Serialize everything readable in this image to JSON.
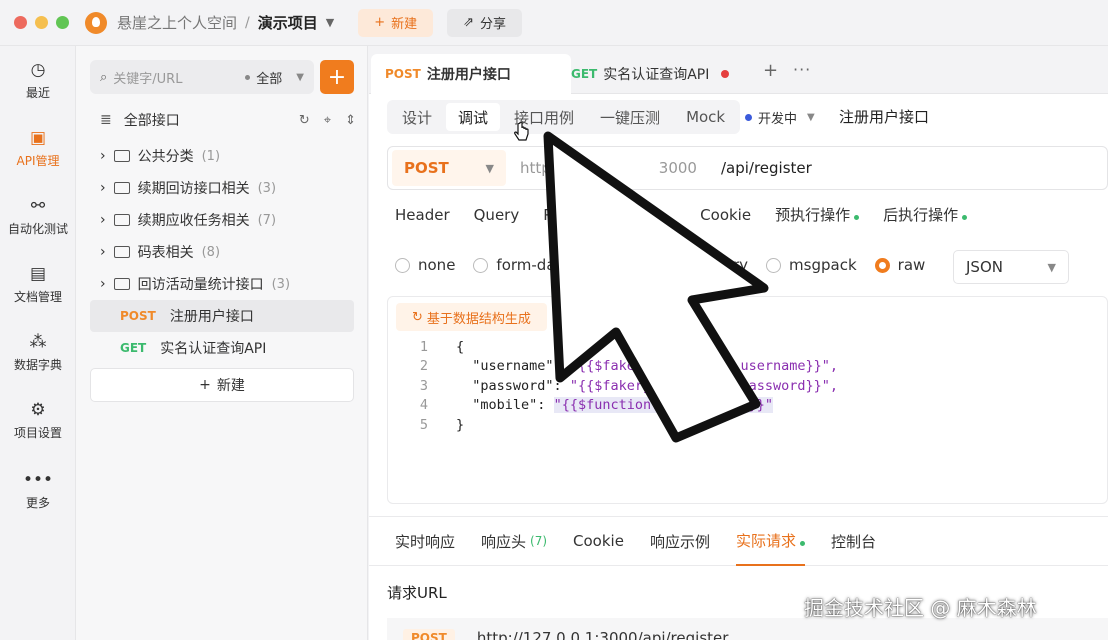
{
  "titlebar": {
    "space_name": "悬崖之上个人空间",
    "separator": "/",
    "project_name": "演示项目",
    "new_label": "新建",
    "share_label": "分享"
  },
  "rail": [
    {
      "label": "最近",
      "icon": "clock-icon"
    },
    {
      "label": "API管理",
      "icon": "api-icon",
      "active": true
    },
    {
      "label": "自动化测试",
      "icon": "automation-icon"
    },
    {
      "label": "文档管理",
      "icon": "document-icon"
    },
    {
      "label": "数据字典",
      "icon": "dictionary-icon"
    },
    {
      "label": "项目设置",
      "icon": "settings-icon"
    },
    {
      "label": "更多",
      "icon": "more-icon"
    }
  ],
  "sidebar": {
    "search_placeholder": "关键字/URL",
    "filter_label": "全部",
    "add_label": "+",
    "tree_title": "全部接口",
    "folders": [
      {
        "name": "公共分类",
        "count": "(1)"
      },
      {
        "name": "续期回访接口相关",
        "count": "(3)"
      },
      {
        "name": "续期应收任务相关",
        "count": "(7)"
      },
      {
        "name": "码表相关",
        "count": "(8)"
      },
      {
        "name": "回访活动量统计接口",
        "count": "(3)"
      }
    ],
    "endpoints": [
      {
        "method": "POST",
        "name": "注册用户接口",
        "selected": true
      },
      {
        "method": "GET",
        "name": "实名认证查询API"
      }
    ],
    "new_label": "新建"
  },
  "tabs": [
    {
      "method": "POST",
      "name": "注册用户接口",
      "active": true
    },
    {
      "method": "GET",
      "name": "实名认证查询API",
      "unsaved": true
    }
  ],
  "mode_tabs": [
    "设计",
    "调试",
    "接口用例",
    "一键压测",
    "Mock"
  ],
  "mode_active": "调试",
  "status": "开发中",
  "api_name": "注册用户接口",
  "request": {
    "method": "POST",
    "host_visible": "http",
    "host_tail": "3000",
    "path": "/api/register"
  },
  "param_tabs": [
    {
      "label": "Header"
    },
    {
      "label": "Query"
    },
    {
      "label": "Path"
    },
    {
      "label": "Cookie"
    },
    {
      "label": "预执行操作",
      "dot": true
    },
    {
      "label": "后执行操作",
      "dot": true
    }
  ],
  "body_types": [
    {
      "label": "none"
    },
    {
      "label": "form-data"
    },
    {
      "label": "binary"
    },
    {
      "label": "msgpack"
    },
    {
      "label": "raw",
      "checked": true
    }
  ],
  "body_format": "JSON",
  "generate_label": "基于数据结构生成",
  "code_lines": [
    {
      "n": "1",
      "text": "{"
    },
    {
      "n": "2",
      "key": "\"username\"",
      "val": "\"{{$fakerjs.Internet.username}}\","
    },
    {
      "n": "3",
      "key": "\"password\"",
      "val": "\"{{$fakerjs.Internet.password}}\","
    },
    {
      "n": "4",
      "key": "\"mobile\"",
      "val": "\"{{$function.fn_mobile()}}\""
    },
    {
      "n": "5",
      "text": "}"
    }
  ],
  "response_tabs": [
    {
      "label": "实时响应"
    },
    {
      "label": "响应头",
      "count": "(7)"
    },
    {
      "label": "Cookie"
    },
    {
      "label": "响应示例"
    },
    {
      "label": "实际请求",
      "active": true,
      "dot": true
    },
    {
      "label": "控制台"
    }
  ],
  "request_url_label": "请求URL",
  "request_url": {
    "method": "POST",
    "url": "http://127.0.0.1:3000/api/register"
  },
  "watermark": "掘金技术社区 @ 麻木森林",
  "colors": {
    "accent": "#f07c1e",
    "post": "#f08a2a",
    "get": "#3cba6e"
  }
}
